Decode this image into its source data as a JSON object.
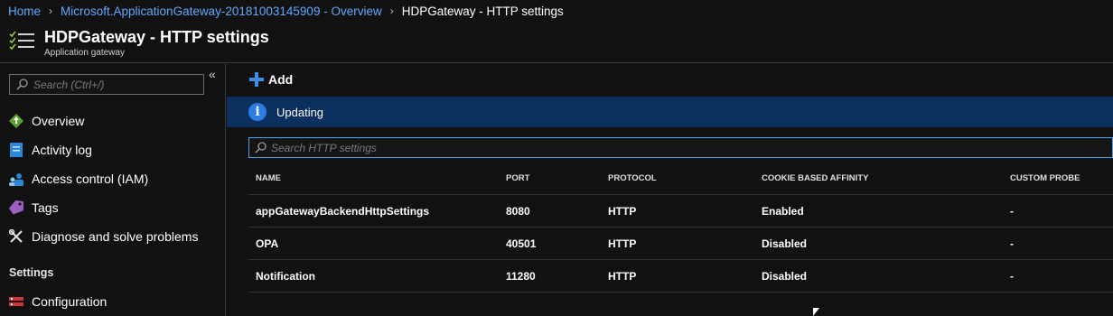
{
  "breadcrumb": {
    "home": "Home",
    "parent": "Microsoft.ApplicationGateway-20181003145909 - Overview",
    "current": "HDPGateway - HTTP settings"
  },
  "header": {
    "title": "HDPGateway - HTTP settings",
    "subtitle": "Application gateway"
  },
  "sidebar": {
    "collapse_glyph": "«",
    "search_placeholder": "Search (Ctrl+/)",
    "items": [
      {
        "label": "Overview",
        "icon": "overview-icon"
      },
      {
        "label": "Activity log",
        "icon": "activity-log-icon"
      },
      {
        "label": "Access control (IAM)",
        "icon": "access-control-icon"
      },
      {
        "label": "Tags",
        "icon": "tag-icon"
      },
      {
        "label": "Diagnose and solve problems",
        "icon": "wrench-icon"
      }
    ],
    "section": "Settings",
    "section_items": [
      {
        "label": "Configuration",
        "icon": "configuration-icon"
      }
    ]
  },
  "toolbar": {
    "add_label": "Add"
  },
  "status": {
    "text": "Updating",
    "icon": "info-icon"
  },
  "table": {
    "search_placeholder": "Search HTTP settings",
    "columns": [
      "NAME",
      "PORT",
      "PROTOCOL",
      "COOKIE BASED AFFINITY",
      "CUSTOM PROBE"
    ],
    "rows": [
      [
        "appGatewayBackendHttpSettings",
        "8080",
        "HTTP",
        "Enabled",
        "-"
      ],
      [
        "OPA",
        "40501",
        "HTTP",
        "Disabled",
        "-"
      ],
      [
        "Notification",
        "11280",
        "HTTP",
        "Disabled",
        "-"
      ]
    ]
  },
  "colors": {
    "background": "#111111",
    "link": "#5ea9ff",
    "accent": "#3c8fe6",
    "status_bar": "#0b2f5e"
  }
}
